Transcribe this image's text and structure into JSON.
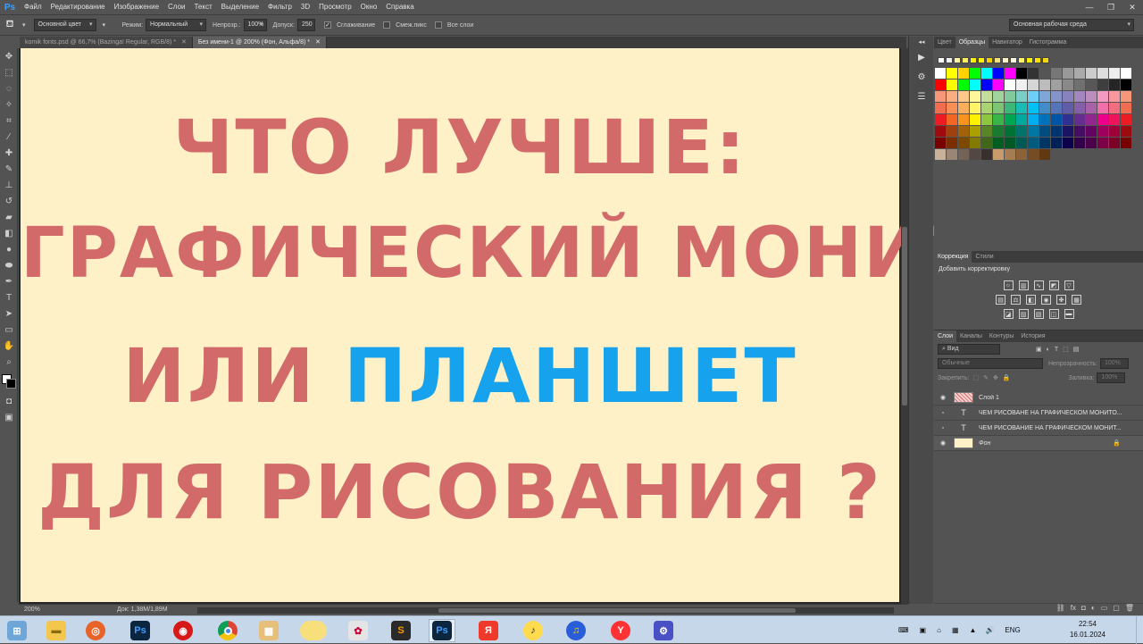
{
  "app": {
    "logo": "Ps"
  },
  "menu": [
    "Файл",
    "Редактирование",
    "Изображение",
    "Слои",
    "Текст",
    "Выделение",
    "Фильтр",
    "3D",
    "Просмотр",
    "Окно",
    "Справка"
  ],
  "window_controls": [
    "—",
    "❐",
    "✕"
  ],
  "options": {
    "sample": "Основной цвет",
    "mode_label": "Режим:",
    "mode": "Нормальный",
    "opacity_label": "Непрозр.:",
    "opacity": "100%",
    "tolerance_label": "Допуск:",
    "tolerance": "250",
    "antialias": "Сглаживание",
    "contiguous": "Смеж.пикс",
    "all_layers": "Все слои",
    "workspace": "Основная рабочая среда"
  },
  "tabs": [
    {
      "label": "komik fonts.psd @ 66,7% (Bazinga! Regular, RGB/8) *",
      "close": "✕"
    },
    {
      "label": "Без имени-1 @ 200% (Фон, Альфа/8) *",
      "close": "✕"
    }
  ],
  "canvas": {
    "line1": "ЧТО ЛУЧШЕ:",
    "line2": "ГРАФИЧЕСКИЙ МОНИТОР",
    "line3_a": "ИЛИ ",
    "line3_b": "ПЛАНШЕТ",
    "line4": "ДЛЯ РИСОВАНИЯ ?",
    "bg_color": "#fef1c7",
    "text_color": "#d26a6a",
    "accent_color": "#16a2ec"
  },
  "status": {
    "zoom": "200%",
    "doc": "Док: 1,38M/1,89M"
  },
  "panels": {
    "color_tabs": [
      "Цвет",
      "Образцы",
      "Навигатор",
      "Гистограмма"
    ],
    "adjust_tabs": [
      "Коррекция",
      "Стили"
    ],
    "adjust_title": "Добавить корректировку",
    "layers_tabs": [
      "Слои",
      "Каналы",
      "Контуры",
      "История"
    ],
    "layer_filter": "Вид",
    "blend_mode": "Обычные",
    "opacity_label": "Непрозрачность:",
    "opacity_value": "100%",
    "lock_label": "Закрепить:",
    "fill_label": "Заливка:",
    "fill_value": "100%",
    "layers": [
      {
        "name": "Слой 1",
        "visible": true,
        "type": "image"
      },
      {
        "name": "ЧЕМ РИСОВАНЕ НА ГРАФИЧЕСКОМ МОНИТО...",
        "visible": false,
        "type": "text"
      },
      {
        "name": "ЧЕМ РИСОВАНИЕ НА ГРАФИЧЕСКОМ МОНИТ...",
        "visible": false,
        "type": "text"
      },
      {
        "name": "Фон",
        "visible": true,
        "type": "background"
      }
    ]
  },
  "taskbar": {
    "apps": [
      "folder",
      "firefox",
      "photoshop",
      "screen-recorder",
      "chrome",
      "file-manager",
      "notes",
      "paint",
      "sublime",
      "photoshop-active",
      "yandex-browser",
      "yandex-music",
      "headphones",
      "yandex",
      "settings"
    ],
    "lang": "ENG",
    "time": "22:54",
    "date": "16.01.2024"
  }
}
